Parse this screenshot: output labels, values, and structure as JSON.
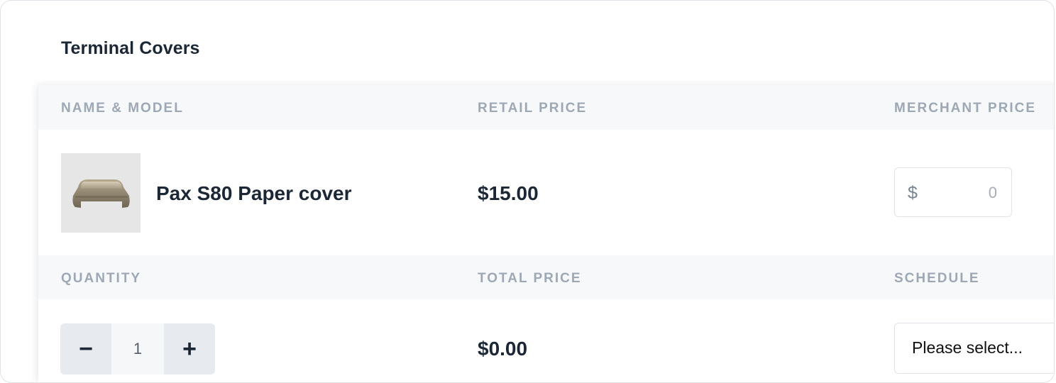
{
  "section": {
    "title": "Terminal Covers"
  },
  "table": {
    "headers_row1": {
      "name_model": "NAME & MODEL",
      "retail_price": "RETAIL PRICE",
      "merchant_price": "MERCHANT PRICE"
    },
    "headers_row2": {
      "quantity": "QUANTITY",
      "total_price": "TOTAL PRICE",
      "schedule": "SCHEDULE"
    },
    "product": {
      "image_icon": "terminal-cover-image",
      "name": "Pax S80 Paper cover",
      "retail_price": "$15.00",
      "merchant_price": {
        "currency": "$",
        "value": "",
        "placeholder": "0"
      },
      "quantity": "1",
      "decrement_label": "−",
      "increment_label": "+",
      "total_price": "$0.00",
      "schedule_selected": "Please select..."
    }
  },
  "colors": {
    "title_text": "#1c2736",
    "header_text": "#9ea8b5",
    "header_bg": "#f6f8fa",
    "border": "#dfe3e8"
  }
}
